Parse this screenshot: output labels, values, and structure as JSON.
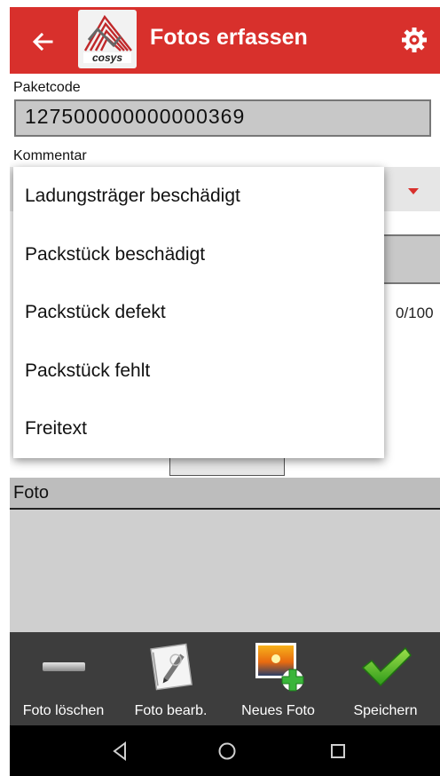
{
  "appbar": {
    "title": "Fotos erfassen",
    "back_icon": "arrow-left-icon",
    "logo_text": "cosys",
    "settings_icon": "gear-icon",
    "color": "#d8302c"
  },
  "form": {
    "paketcode_label": "Paketcode",
    "paketcode_value": "127500000000000369",
    "kommentar_label": "Kommentar",
    "char_counter": "0/100"
  },
  "dropdown": {
    "options": [
      "Ladungsträger beschädigt",
      "Packstück beschädigt",
      "Packstück defekt",
      "Packstück fehlt",
      "Freitext"
    ]
  },
  "foto_section": {
    "label": "Foto"
  },
  "toolbar": {
    "items": [
      {
        "label": "Foto löschen",
        "icon": "minus-icon"
      },
      {
        "label": "Foto bearb.",
        "icon": "edit-notebook-icon"
      },
      {
        "label": "Neues Foto",
        "icon": "add-photo-icon"
      },
      {
        "label": "Speichern",
        "icon": "checkmark-icon"
      }
    ]
  },
  "navbar": {
    "icons": [
      "back-triangle-icon",
      "home-circle-icon",
      "recents-square-icon"
    ]
  }
}
